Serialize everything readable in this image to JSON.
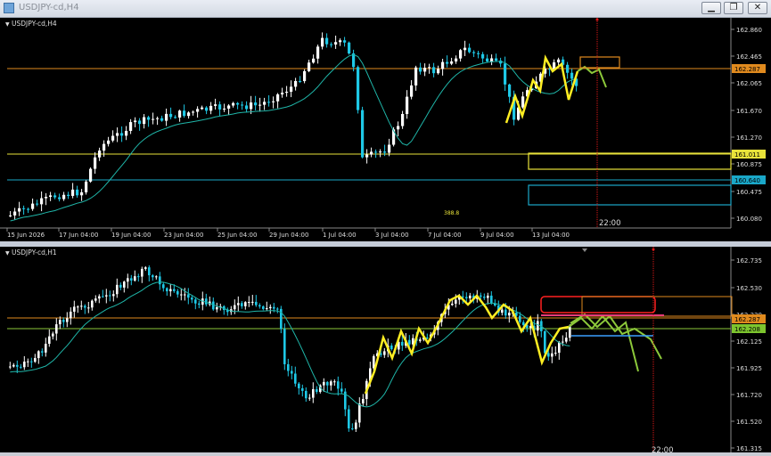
{
  "window": {
    "title": "USDJPY-cd,H4"
  },
  "top_chart": {
    "symbol_label": "USDJPY-cd,H4",
    "price_labels": [
      "162.860",
      "162.465",
      "162.065",
      "161.670",
      "161.270",
      "160.875",
      "160.475",
      "160.080"
    ],
    "highlight_labels": [
      {
        "text": "162.287",
        "bg": "#e08a1e",
        "fg": "#000000"
      },
      {
        "text": "161.011",
        "bg": "#e8e23a",
        "fg": "#000000"
      },
      {
        "text": "160.640",
        "bg": "#1aa7c8",
        "fg": "#000000"
      }
    ],
    "time_labels": [
      "15 Jun 2026",
      "17 Jun 04:00",
      "19 Jun 04:00",
      "23 Jun 04:00",
      "25 Jun 04:00",
      "29 Jun 04:00",
      "1 Jul 04:00",
      "3 Jul 04:00",
      "7 Jul 04:00",
      "9 Jul 04:00",
      "13 Jul 04:00"
    ],
    "crosshair_time": "22:00",
    "center_marker": "388.8"
  },
  "bottom_chart": {
    "symbol_label": "USDJPY-cd,H1",
    "price_labels": [
      "162.735",
      "162.530",
      "162.330",
      "162.125",
      "161.925",
      "161.720",
      "161.520",
      "161.315"
    ],
    "highlight_labels": [
      {
        "text": "162.287",
        "bg": "#e08a1e",
        "fg": "#000000"
      },
      {
        "text": "162.208",
        "bg": "#7dc52e",
        "fg": "#000000"
      }
    ],
    "crosshair_time": "22:00"
  },
  "colors": {
    "bull": "#ffffff",
    "bear": "#1ec8e6",
    "ma": "#1fb5a8",
    "zigzag": "#ffee22",
    "projection": "#8cc83a",
    "orange": "#e08a1e",
    "yellow": "#e8e23a",
    "cyan": "#1aa7c8",
    "red": "#ff2020",
    "crosshair": "#e01818"
  }
}
